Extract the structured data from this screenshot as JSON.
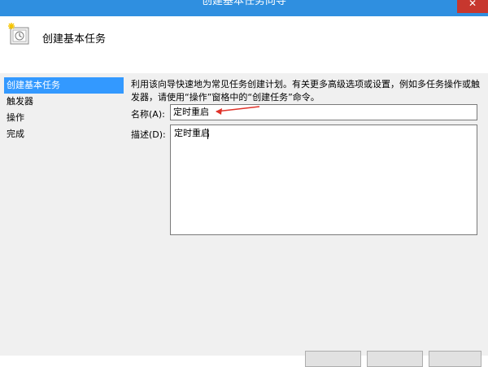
{
  "window": {
    "title": "创建基本任务向导",
    "close_label": "✕"
  },
  "header": {
    "title": "创建基本任务",
    "icon": "task-wizard-icon"
  },
  "sidebar": {
    "items": [
      {
        "label": "创建基本任务",
        "active": true
      },
      {
        "label": "触发器",
        "active": false
      },
      {
        "label": "操作",
        "active": false
      },
      {
        "label": "完成",
        "active": false
      }
    ]
  },
  "main": {
    "description": "利用该向导快速地为常见任务创建计划。有关更多高级选项或设置，例如多任务操作或触发器，请使用“操作”窗格中的“创建任务”命令。",
    "name_label": "名称",
    "name_accesskey": "(A):",
    "name_value": "定时重启",
    "desc_label": "描述",
    "desc_accesskey": "(D):",
    "desc_value": "定时重启"
  },
  "colors": {
    "titlebar": "#2f8fe0",
    "selected": "#3399ff",
    "annotation_arrow": "#e0332a"
  }
}
